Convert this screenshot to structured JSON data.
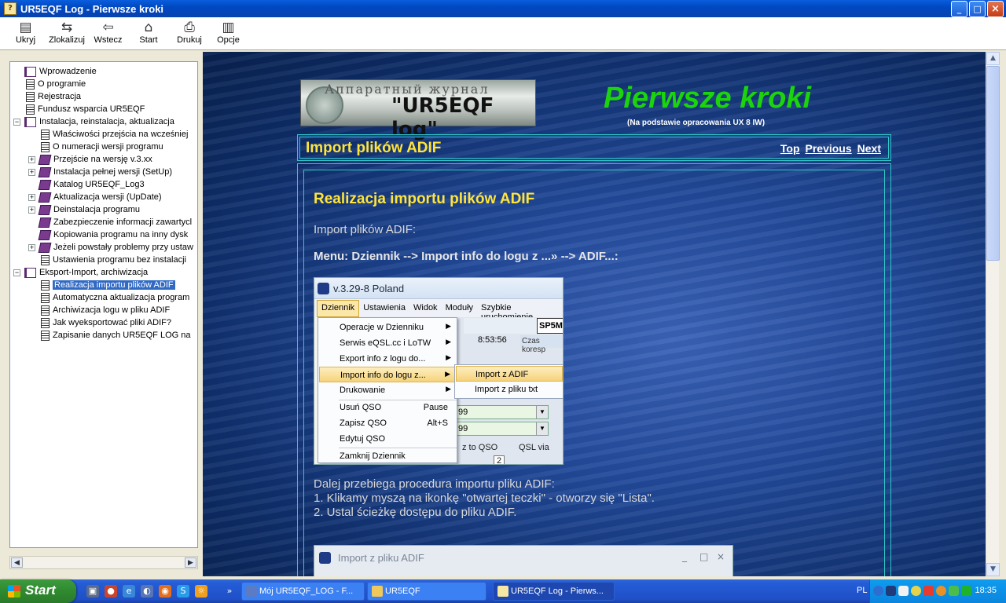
{
  "window": {
    "title": "UR5EQF Log - Pierwsze kroki"
  },
  "toolbar": {
    "buttons": [
      {
        "label": "Ukryj",
        "icon": "hide-icon"
      },
      {
        "label": "Zlokalizuj",
        "icon": "locate-icon"
      },
      {
        "label": "Wstecz",
        "icon": "back-arrow-icon"
      },
      {
        "label": "Start",
        "icon": "home-icon"
      },
      {
        "label": "Drukuj",
        "icon": "printer-icon"
      },
      {
        "label": "Opcje",
        "icon": "options-icon"
      }
    ]
  },
  "tree": {
    "items": [
      {
        "label": "Wprowadzenie"
      },
      {
        "label": "O programie"
      },
      {
        "label": "Rejestracja"
      },
      {
        "label": "Fundusz wsparcia UR5EQF"
      },
      {
        "label": "Instalacja, reinstalacja, aktualizacja"
      },
      {
        "label": "Właściwości przejścia na wcześniej"
      },
      {
        "label": "O numeracji wersji programu"
      },
      {
        "label": "Przejście na wersję v.3.xx"
      },
      {
        "label": "Instalacja pełnej wersji (SetUp)"
      },
      {
        "label": "Katalog UR5EQF_Log3"
      },
      {
        "label": "Aktualizacja wersji (UpDate)"
      },
      {
        "label": "Deinstalacja programu"
      },
      {
        "label": "Zabezpieczenie informacji zawartycl"
      },
      {
        "label": "Kopiowania programu na inny dysk"
      },
      {
        "label": "Jeżeli powstały problemy przy ustaw"
      },
      {
        "label": "Ustawienia programu bez instalacji"
      },
      {
        "label": "Eksport-Import, archiwizacja"
      },
      {
        "label": "Realizacja importu plików ADIF"
      },
      {
        "label": "Automatyczna aktualizacja program"
      },
      {
        "label": "Archiwizacja logu w pliku ADIF"
      },
      {
        "label": "Jak wyeksportować pliki ADIF?"
      },
      {
        "label": "Zapisanie danych UR5EQF LOG na"
      }
    ],
    "selected": "Realizacja importu plików ADIF"
  },
  "content": {
    "logo_line1": "Аппаратный журнал",
    "logo_line2": "\"UR5EQF log\"",
    "heading": "Pierwsze kroki",
    "subheading": "(Na podstawie opracowania UX 8 IW)",
    "topic_title": "Import plików ADIF",
    "nav": {
      "top": "Top",
      "previous": "Previous",
      "next": "Next"
    },
    "section_title": "Realizacja importu plików ADIF",
    "intro": "Import plików ADIF:",
    "menu_path": "Menu: Dziennik --> Import info do logu z ...» --> ADIF...:",
    "step0": "Dalej przebiega procedura importu pliku ADIF:",
    "step1": "1. Klikamy myszą na ikonkę \"otwartej teczki\" - otworzy się \"Lista\".",
    "step2": "2. Ustal ścieżkę dostępu do pliku ADIF."
  },
  "screenshot1": {
    "title": "v.3.29-8 Poland",
    "menubar": [
      "Dziennik",
      "Ustawienia",
      "Widok",
      "Moduły",
      "Szybkie uruchomienie"
    ],
    "callsign": "SP5M",
    "time": "8:53:56",
    "czas": "Czas koresp",
    "menu_items": [
      {
        "label": "Operacje w Dzienniku",
        "submenu": true
      },
      {
        "label": "Serwis eQSL.cc i LoTW",
        "submenu": true
      },
      {
        "label": "Export info z logu do...",
        "submenu": true
      },
      {
        "label": "Import  info do logu z...",
        "submenu": true
      },
      {
        "label": "Drukowanie",
        "submenu": true
      },
      {
        "label": "Usuń QSO",
        "shortcut": "Pause"
      },
      {
        "label": "Zapisz QSO",
        "shortcut": "Alt+S"
      },
      {
        "label": "Edytuj QSO"
      },
      {
        "label": "Zamknij Dziennik"
      }
    ],
    "submenu_items": [
      "Import z ADIF",
      "Import z pliku txt"
    ],
    "combo1": "99",
    "combo2": "99",
    "bottom_left": "z to QSO",
    "bottom_right": "QSL via",
    "bottom_num": "2"
  },
  "screenshot2": {
    "title": "Import z pliku ADIF",
    "buttons": [
      "_",
      "□",
      "×"
    ]
  },
  "taskbar": {
    "start": "Start",
    "tasks": [
      {
        "label": "Mój UR5EQF_LOG - F..."
      },
      {
        "label": "UR5EQF"
      },
      {
        "label": "UR5EQF Log - Pierws..."
      }
    ],
    "lang": "PL",
    "clock": "18:35"
  },
  "colors": {
    "heading_green": "#1cd40c",
    "topic_yellow": "#ffe43a",
    "frame_cyan": "#2ec8c8",
    "xp_blue": "#245dd7"
  }
}
